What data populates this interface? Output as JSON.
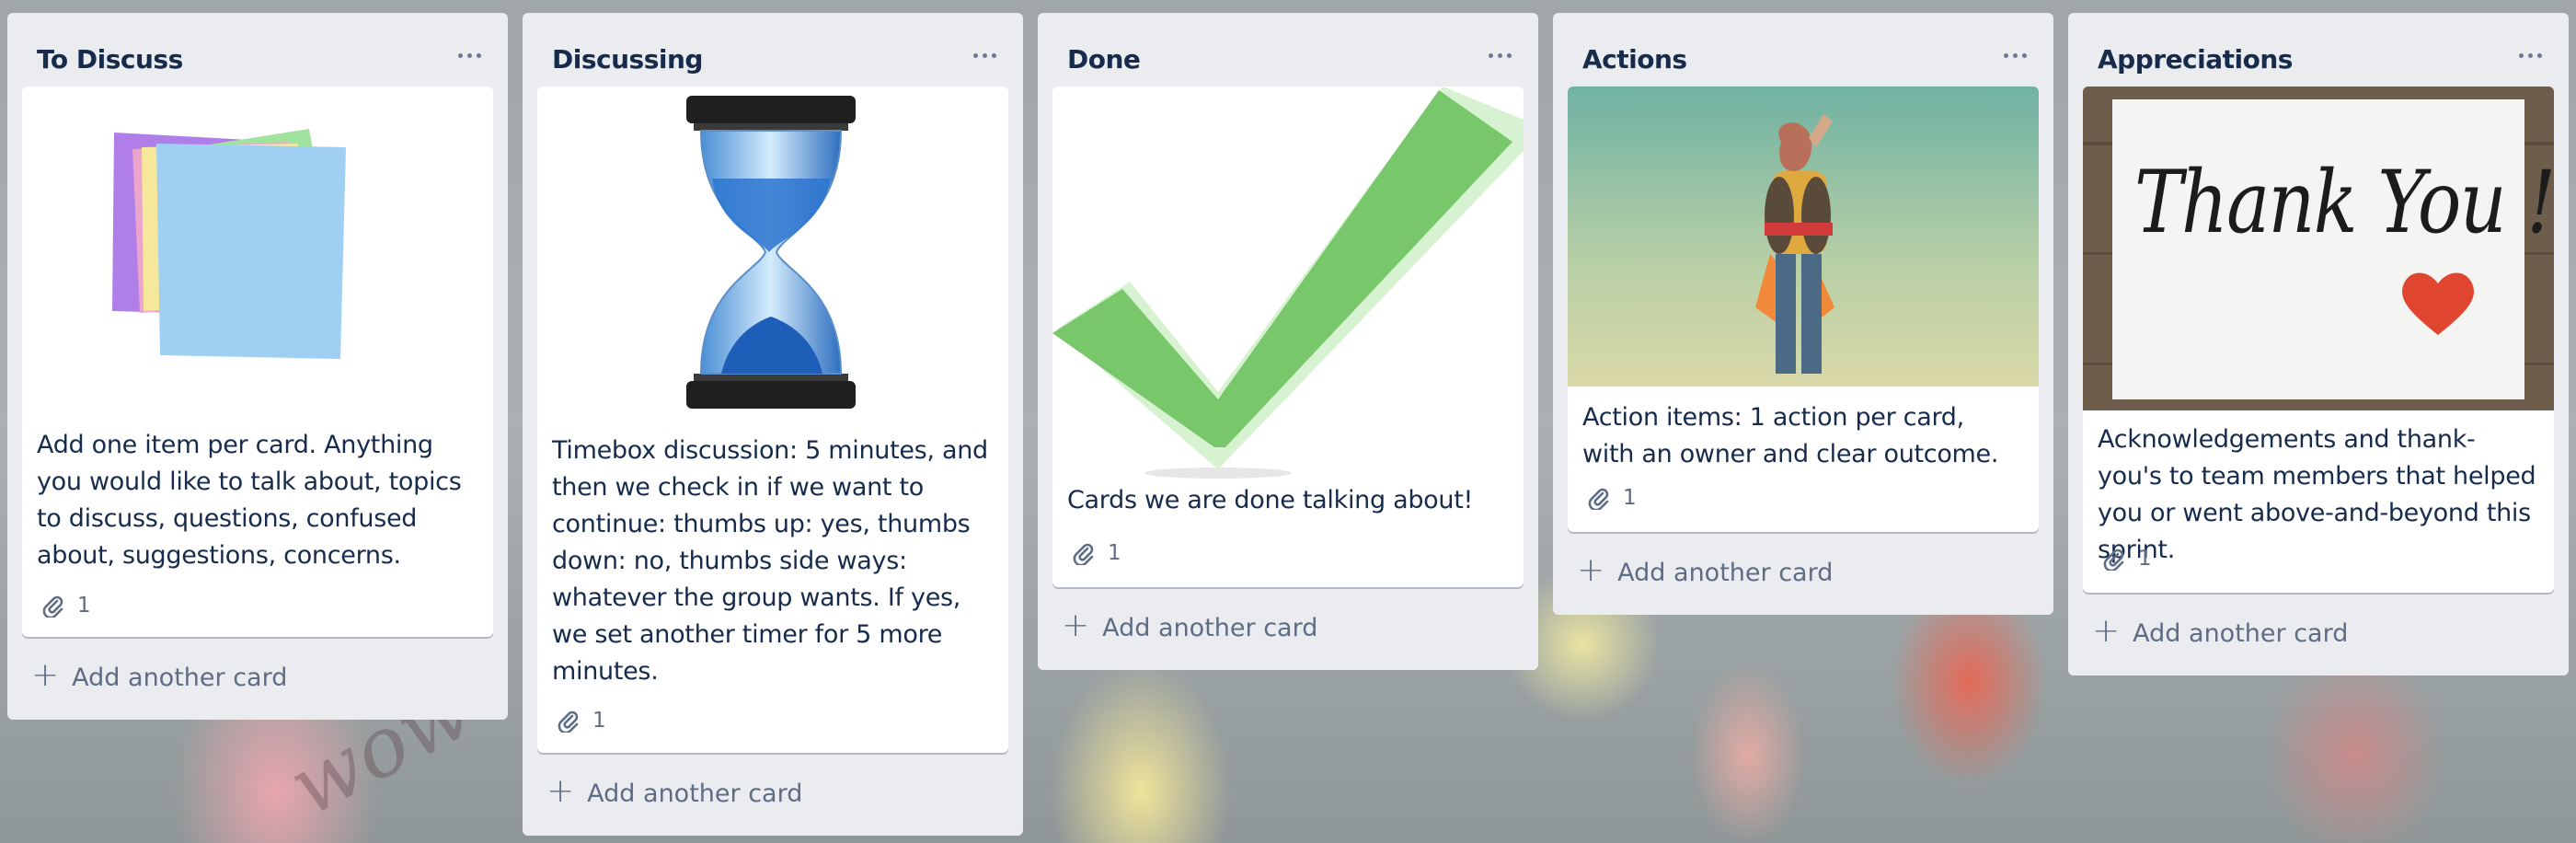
{
  "lists": [
    {
      "title": "To Discuss",
      "card": {
        "cover": "sticky-notes",
        "text": "Add one item per card. Anything you would like to talk about, topics to discuss, questions, confused about, suggestions, concerns.",
        "attachments": "1"
      },
      "add_card_label": "Add another card"
    },
    {
      "title": "Discussing",
      "card": {
        "cover": "hourglass",
        "text": "Timebox discussion: 5 minutes, and then we check in if we want to continue: thumbs up: yes, thumbs down: no, thumbs side ways: whatever the group wants. If yes, we set another timer for 5 more minutes.",
        "attachments": "1"
      },
      "add_card_label": "Add another card"
    },
    {
      "title": "Done",
      "card": {
        "cover": "checkmark",
        "text": "Cards we are done talking about!",
        "attachments": "1"
      },
      "add_card_label": "Add another card"
    },
    {
      "title": "Actions",
      "card": {
        "cover": "jetpack-person",
        "text": "Action items: 1 action per card, with an owner and clear outcome.",
        "attachments": "1"
      },
      "add_card_label": "Add another card"
    },
    {
      "title": "Appreciations",
      "card": {
        "cover": "thank-you-note",
        "cover_text": "Thank You !",
        "text": "Acknowledgements and thank-you's to team members that helped you or went above-and-beyond this sprint.",
        "attachments": "1"
      },
      "add_card_label": "Add another card"
    }
  ],
  "colors": {
    "list_bg": "#ebecf0",
    "card_bg": "#ffffff",
    "text": "#172b4d",
    "muted": "#5e6c84"
  }
}
